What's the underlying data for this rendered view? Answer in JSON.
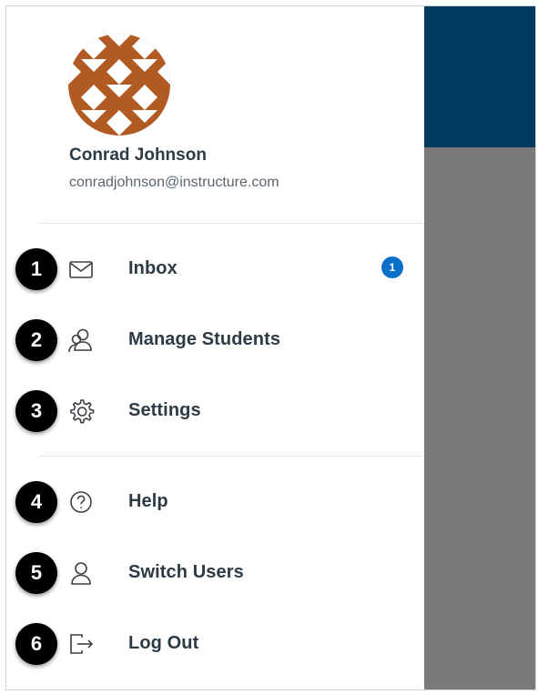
{
  "user": {
    "name": "Conrad Johnson",
    "email": "conradjohnson@instructure.com",
    "avatar_icon": "patterned-avatar-icon",
    "avatar_color": "#b25a23"
  },
  "menu": {
    "items": [
      {
        "label": "Inbox",
        "icon": "mail-icon",
        "callout": "1",
        "badge": "1"
      },
      {
        "label": "Manage Students",
        "icon": "users-icon",
        "callout": "2"
      },
      {
        "label": "Settings",
        "icon": "gear-icon",
        "callout": "3"
      },
      {
        "label": "Help",
        "icon": "help-icon",
        "callout": "4"
      },
      {
        "label": "Switch Users",
        "icon": "user-icon",
        "callout": "5"
      },
      {
        "label": "Log Out",
        "icon": "logout-icon",
        "callout": "6"
      }
    ]
  },
  "colors": {
    "header": "#003a5f",
    "badge": "#0b6ec9",
    "text": "#2d3b45",
    "overlay": "#7a7a7a"
  }
}
